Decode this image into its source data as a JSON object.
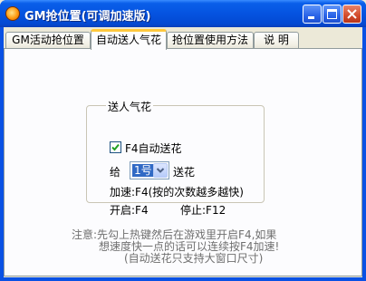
{
  "window": {
    "title": "GM抢位置(可调加速版)",
    "accent": "#0A51E4",
    "controls": [
      "minimize-icon",
      "maximize-icon",
      "close-icon"
    ]
  },
  "tabs": [
    {
      "label": "GM活动抢位置",
      "active": false
    },
    {
      "label": "自动送人气花",
      "active": true
    },
    {
      "label": "抢位置使用方法",
      "active": false
    },
    {
      "label": "说  明",
      "active": false
    }
  ],
  "group": {
    "legend": "送人气花",
    "checkbox_label": "F4自动送花",
    "checkbox_checked": true,
    "give_prefix": "给",
    "combo_value": "1号",
    "give_suffix": "送花",
    "speed_text": "加速:F4(按的次数越多越快)",
    "start_text": "开启:F4",
    "stop_text": "停止:F12"
  },
  "notes": {
    "line1": "注意:先勾上热键然后在游戏里开启F4,如果",
    "line2": "想速度快一点的话可以连续按F4加速!",
    "line3": "(自动送花只支持大窗口尺寸)"
  }
}
